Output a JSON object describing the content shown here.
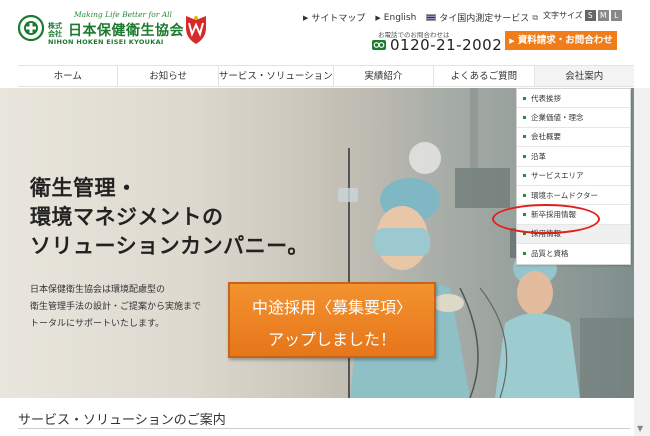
{
  "header": {
    "logo": {
      "tagline": "Making Life Better for All",
      "prefix": "株式会社",
      "name": "日本保健衛生協会",
      "name_en": "NIHON HOKEN EISEI KYOUKAI",
      "brand_color": "#1c7a2e"
    },
    "util_links": [
      "サイトマップ",
      "English",
      "タイ国内測定サービス"
    ],
    "fontsize": {
      "label": "文字サイズ",
      "options": [
        "S",
        "M",
        "L"
      ]
    },
    "phone_label": "お電話でのお問合わせは",
    "phone_number": "0120-21-2002",
    "cta_label": "資料請求・お問合わせ",
    "cta_color": "#f07d1a"
  },
  "nav": {
    "items": [
      "ホーム",
      "お知らせ",
      "サービス・ソリューション",
      "実績紹介",
      "よくあるご質問",
      "会社案内"
    ],
    "active_index": 5
  },
  "dropdown": {
    "items": [
      "代表挨拶",
      "企業価値・理念",
      "会社概要",
      "沿革",
      "サービスエリア",
      "環境ホームドクター",
      "新卒採用情報",
      "採用情報",
      "品質と資格"
    ],
    "highlighted": "採用情報",
    "highlight_color": "#e0201c"
  },
  "hero": {
    "headline": [
      "衛生管理・",
      "環境マネジメントの",
      "ソリューションカンパニー。"
    ],
    "body": [
      "日本保健衛生協会は環境配慮型の",
      "衛生管理手法の設計・ご提案から実施まで",
      "トータルにサポートいたします。"
    ],
    "banner_line1": "中途採用〈募集要項〉",
    "banner_line2": "アップしました！",
    "banner_color": "#f07d1a"
  },
  "section": {
    "title": "サービス・ソリューションのご案内"
  }
}
